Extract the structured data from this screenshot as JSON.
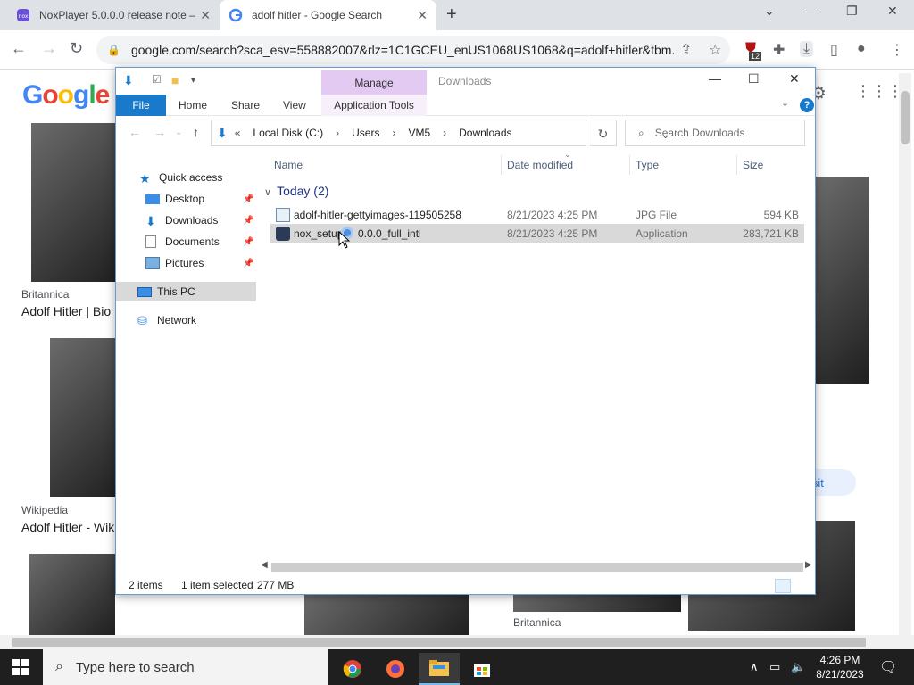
{
  "browser": {
    "tabs": [
      {
        "title": "NoxPlayer 5.0.0.0 release note –",
        "close": "✕"
      },
      {
        "title": "adolf hitler - Google Search",
        "close": "✕"
      }
    ],
    "new_tab": "+",
    "url": "google.com/search?sca_esv=558882007&rlz=1C1GCEU_enUS1068US1068&q=adolf+hitler&tbm...",
    "extension_badge": "12",
    "window_controls": {
      "dropdown": "⌄",
      "minimize": "—",
      "restore": "❐",
      "close": "✕"
    }
  },
  "google": {
    "logo": [
      "G",
      "o",
      "o",
      "g",
      "l",
      "e"
    ],
    "results": [
      {
        "source": "Britannica",
        "title": "Adolf Hitler | Bio"
      },
      {
        "source": "Wikipedia",
        "title": "Adolf Hitler - Wik"
      },
      {
        "source": "Britannica",
        "title": ""
      }
    ],
    "visit_label": "isit",
    "panel_close": "✕"
  },
  "explorer": {
    "title": "Downloads",
    "manage_tab": "Manage",
    "ribbon_tabs": [
      "File",
      "Home",
      "Share",
      "View",
      "Application Tools"
    ],
    "help": "?",
    "breadcrumb": [
      "«",
      "Local Disk (C:)",
      "Users",
      "VM5",
      "Downloads"
    ],
    "search_placeholder": "Search Downloads",
    "nav": {
      "quick_access": "Quick access",
      "items": [
        "Desktop",
        "Downloads",
        "Documents",
        "Pictures"
      ],
      "this_pc": "This PC",
      "network": "Network"
    },
    "columns": [
      "Name",
      "Date modified",
      "Type",
      "Size"
    ],
    "group": "Today (2)",
    "files": [
      {
        "name": "adolf-hitler-gettyimages-119505258",
        "date": "8/21/2023 4:25 PM",
        "type": "JPG File",
        "size": "594 KB"
      },
      {
        "name_before": "nox_setup",
        "name_after": "0.0.0_full_intl",
        "date": "8/21/2023 4:25 PM",
        "type": "Application",
        "size": "283,721 KB"
      }
    ],
    "status": {
      "count": "2 items",
      "selected": "1 item selected",
      "size": "277 MB"
    }
  },
  "taskbar": {
    "search_placeholder": "Type here to search",
    "time": "4:26 PM",
    "date": "8/21/2023"
  }
}
